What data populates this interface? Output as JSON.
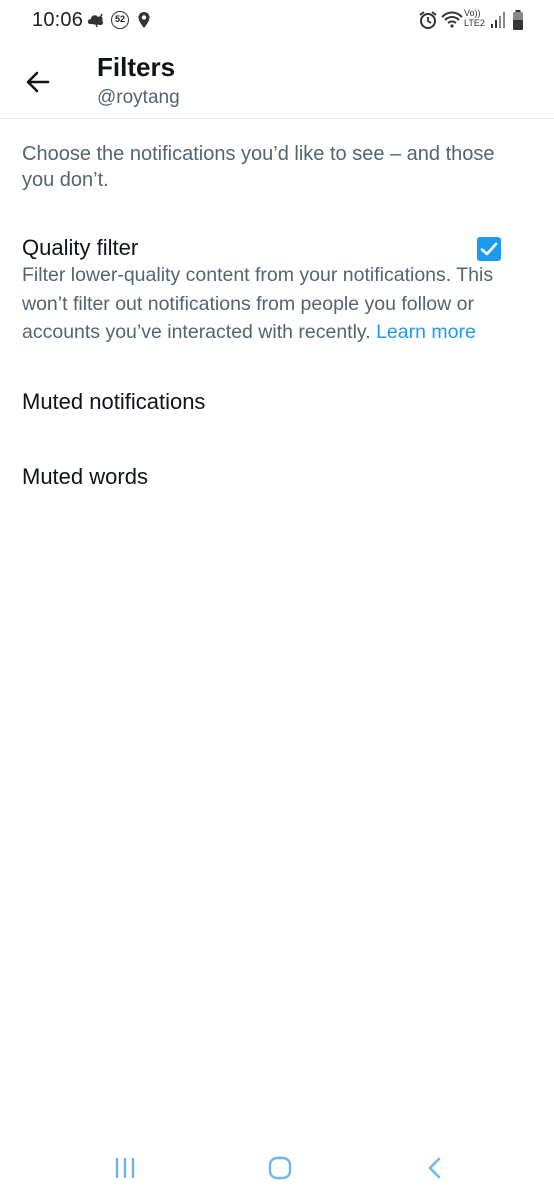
{
  "status_bar": {
    "time": "10:06",
    "notification_count": "52",
    "lte_top": "Vo))",
    "lte_bottom": "LTE2",
    "icons": [
      "weather-icon",
      "location-icon",
      "alarm-icon",
      "wifi-icon",
      "signal-icon",
      "battery-icon"
    ]
  },
  "header": {
    "title": "Filters",
    "subtitle": "@roytang",
    "back_icon": "back-arrow-icon"
  },
  "intro": "Choose the notifications you’d like to see – and those you don’t.",
  "quality_filter": {
    "title": "Quality filter",
    "checked": true,
    "description": "Filter lower-quality content from your notifications. This won’t filter out notifications from people you follow or accounts you’ve interacted with recently.",
    "link": "Learn more"
  },
  "menu": [
    {
      "label": "Muted notifications"
    },
    {
      "label": "Muted words"
    }
  ],
  "nav_bar": {
    "buttons": [
      "recents-icon",
      "home-icon",
      "back-icon"
    ]
  },
  "colors": {
    "accent": "#1d9bf0",
    "text_primary": "#0f1419",
    "text_secondary": "#536471",
    "nav_icon": "#6fb4ea"
  }
}
